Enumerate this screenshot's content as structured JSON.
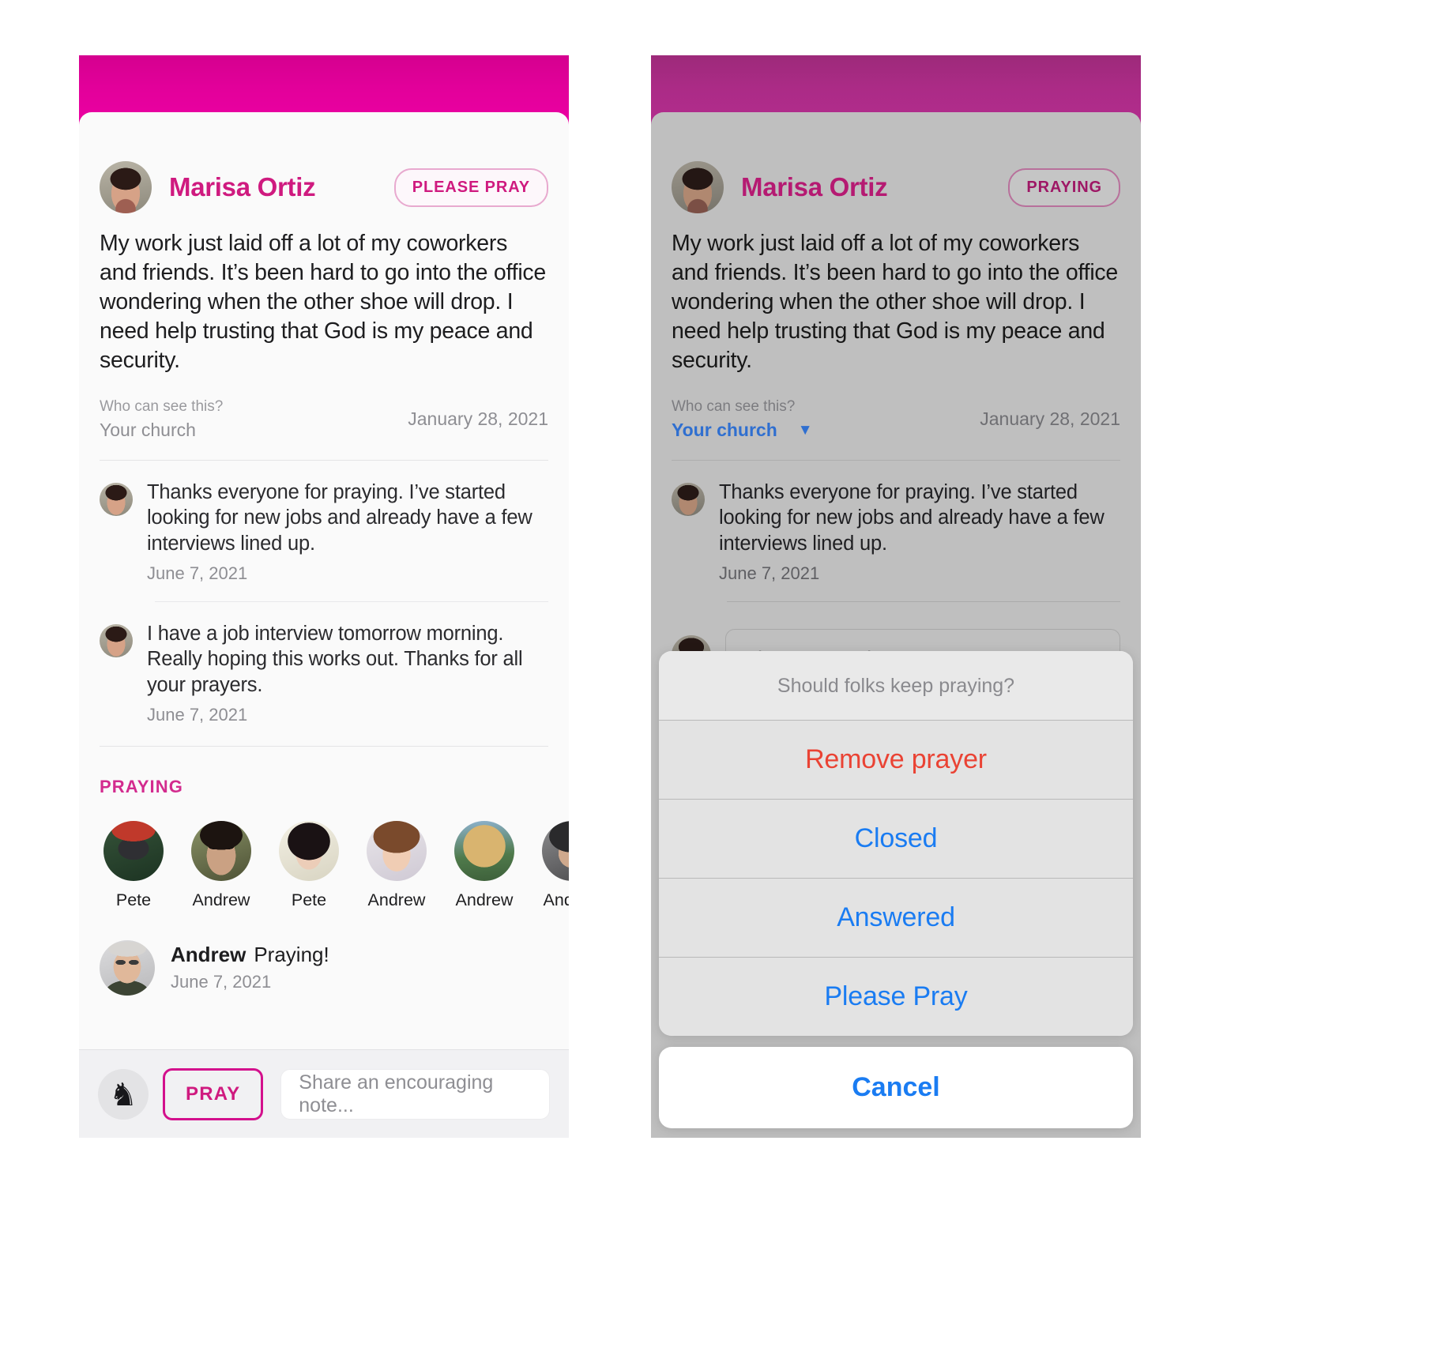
{
  "post": {
    "author": "Marisa Ortiz",
    "body": "My work just laid off a lot of my coworkers and friends. It’s been hard to go into the office wondering when the other shoe will drop. I need help trusting that God is my peace and security.",
    "visibility_question": "Who can see this?",
    "visibility_value": "Your church",
    "visibility_caret": "▼",
    "date": "January 28, 2021",
    "status_left": "PLEASE PRAY",
    "status_right": "PRAYING"
  },
  "comments": [
    {
      "text": "Thanks everyone for praying. I’ve started looking for new jobs and already have a few interviews lined up.",
      "date": "June 7, 2021"
    },
    {
      "text": "I have a job interview tomorrow morning. Really hoping this works out. Thanks for all your prayers.",
      "date": "June 7, 2021"
    }
  ],
  "praying": {
    "label": "PRAYING",
    "people": [
      {
        "name": "Pete"
      },
      {
        "name": "Andrew"
      },
      {
        "name": "Pete"
      },
      {
        "name": "Andrew"
      },
      {
        "name": "Andrew"
      },
      {
        "name": "Andrew"
      }
    ]
  },
  "reaction": {
    "who": "Andrew",
    "message": "Praying!",
    "date": "June 7, 2021"
  },
  "pray_bar": {
    "pray_label": "PRAY",
    "note_placeholder": "Share an encouraging note...",
    "avatar_glyph": "♞"
  },
  "update_composer": {
    "placeholder": "Share an update..."
  },
  "action_sheet": {
    "title": "Should folks keep praying?",
    "items": [
      {
        "label": "Remove prayer",
        "style": "destructive"
      },
      {
        "label": "Closed",
        "style": "normal"
      },
      {
        "label": "Answered",
        "style": "normal"
      },
      {
        "label": "Please Pray",
        "style": "normal"
      }
    ],
    "cancel_label": "Cancel"
  },
  "colors": {
    "brand_pink": "#cf1a7f",
    "header_gradient_start": "#d5008f",
    "header_gradient_end": "#ec00a3",
    "ios_blue": "#1a7cf2",
    "destructive_red": "#ea4334",
    "dim_overlay": "#bfbfbf"
  }
}
